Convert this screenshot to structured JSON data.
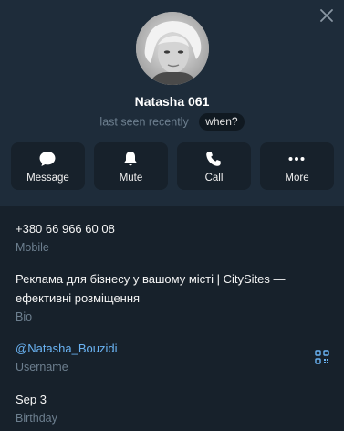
{
  "profile": {
    "name": "Natasha 061",
    "status": "last seen recently",
    "when_label": "when?"
  },
  "actions": [
    {
      "label": "Message",
      "icon": "message-icon"
    },
    {
      "label": "Mute",
      "icon": "bell-icon"
    },
    {
      "label": "Call",
      "icon": "phone-icon"
    },
    {
      "label": "More",
      "icon": "more-icon"
    }
  ],
  "info": {
    "phone": {
      "value": "+380 66 966 60 08",
      "label": "Mobile"
    },
    "bio": {
      "line1": "Реклама для бізнесу у вашому місті | CitySites —",
      "line2": "ефективні розміщення",
      "label": "Bio"
    },
    "username": {
      "value": "@Natasha_Bouzidi",
      "label": "Username"
    },
    "birthday": {
      "value": "Sep 3",
      "label": "Birthday"
    }
  },
  "colors": {
    "header_bg": "#1e2c3a",
    "body_bg": "#17212b",
    "link": "#6ab3f3",
    "muted": "#6d7f8f"
  }
}
